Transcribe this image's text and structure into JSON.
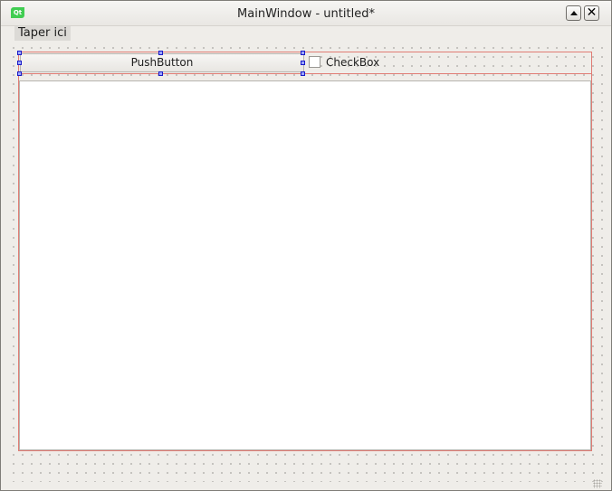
{
  "window": {
    "title": "MainWindow - untitled*",
    "app_icon_text": "Qt"
  },
  "menubar": {
    "items": [
      {
        "label": "Taper ici"
      }
    ]
  },
  "form": {
    "push_button_label": "PushButton",
    "checkbox_label": "CheckBox",
    "checkbox_checked": false,
    "text_edit_value": ""
  },
  "colors": {
    "layout_border": "#e07c74",
    "selection_handle_fill": "#9aa6ff",
    "selection_handle_border": "#1a1ac8",
    "window_background": "#efede9",
    "qt_brand": "#41cd52"
  }
}
